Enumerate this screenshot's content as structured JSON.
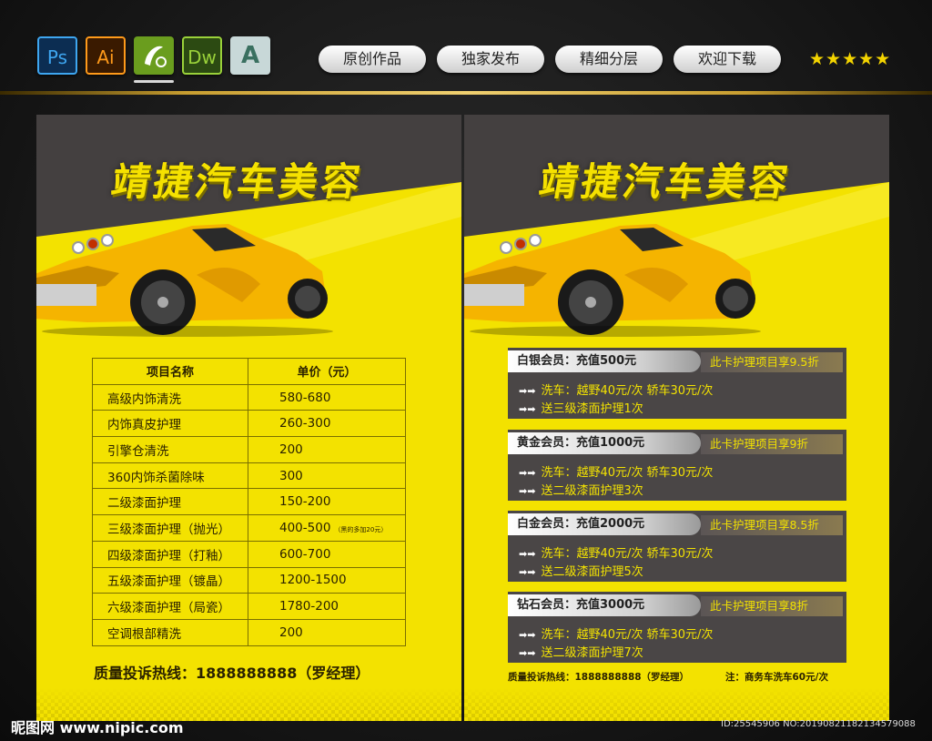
{
  "header": {
    "app_icons": [
      {
        "label": "Ps",
        "icon": "photoshop-icon"
      },
      {
        "label": "Ai",
        "icon": "illustrator-icon"
      },
      {
        "label": "",
        "icon": "coreldraw-icon"
      },
      {
        "label": "Dw",
        "icon": "dreamweaver-icon"
      },
      {
        "label": "A",
        "icon": "autocad-icon"
      }
    ],
    "pills": [
      "原创作品",
      "独家发布",
      "精细分层",
      "欢迎下载"
    ],
    "stars": "★★★★★",
    "rating": 5
  },
  "left_flyer": {
    "title": "靖捷汽车美容",
    "table": {
      "headers": [
        "项目名称",
        "单价（元）"
      ],
      "rows": [
        {
          "item": "高级内饰清洗",
          "price": "580-680"
        },
        {
          "item": "内饰真皮护理",
          "price": "260-300"
        },
        {
          "item": "引擎仓清洗",
          "price": "200"
        },
        {
          "item": "360内饰杀菌除味",
          "price": "300"
        },
        {
          "item": "二级漆面护理",
          "price": "150-200"
        },
        {
          "item": "三级漆面护理（抛光）",
          "price": "400-500",
          "note": "（黑的多加20元）"
        },
        {
          "item": "四级漆面护理（打釉）",
          "price": "600-700"
        },
        {
          "item": "五级漆面护理（镀晶）",
          "price": "1200-1500"
        },
        {
          "item": "六级漆面护理（局瓷）",
          "price": "1780-200"
        },
        {
          "item": "空调根部精洗",
          "price": "200"
        }
      ]
    },
    "hotline": "质量投诉热线：1888888888（罗经理）"
  },
  "right_flyer": {
    "title": "靖捷汽车美容",
    "members": [
      {
        "head": "白银会员：充值500元",
        "discount": "此卡护理项目享9.5折",
        "line1": "洗车：越野40元/次   轿车30元/次",
        "line2": "送三级漆面护理1次"
      },
      {
        "head": "黄金会员：充值1000元",
        "discount": "此卡护理项目享9折",
        "line1": "洗车：越野40元/次   轿车30元/次",
        "line2": "送二级漆面护理3次"
      },
      {
        "head": "白金会员：充值2000元",
        "discount": "此卡护理项目享8.5折",
        "line1": "洗车：越野40元/次   轿车30元/次",
        "line2": "送二级漆面护理5次"
      },
      {
        "head": "钻石会员：充值3000元",
        "discount": "此卡护理项目享8折",
        "line1": "洗车：越野40元/次   轿车30元/次",
        "line2": "送二级漆面护理7次"
      }
    ],
    "hotline": "质量投诉热线：1888888888（罗经理）",
    "note": "注：商务车洗车60元/次"
  },
  "watermark": {
    "site": "昵图网 www.nipic.com",
    "id": "ID:25545906 NO:20190821182134579088"
  },
  "colors": {
    "accent_yellow": "#f3e200",
    "dark_gray": "#444040",
    "car_yellow": "#f5b400"
  }
}
